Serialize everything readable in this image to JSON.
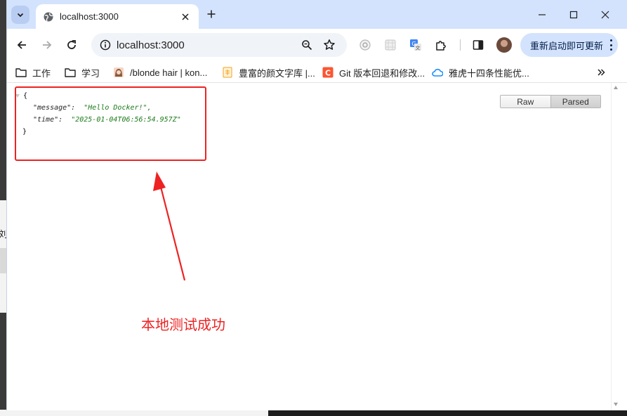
{
  "browser": {
    "tab": {
      "title": "localhost:3000"
    },
    "omnibox": {
      "url": "localhost:3000"
    },
    "update_button_label": "重新启动即可更新",
    "bookmarks": [
      {
        "label": "工作",
        "icon": "folder-icon"
      },
      {
        "label": "学习",
        "icon": "folder-icon"
      },
      {
        "label": "/blonde hair | kon...",
        "icon": "avatar-favicon"
      },
      {
        "label": "豊富的颜文字库 |...",
        "icon": "doc-favicon"
      },
      {
        "label": "Git 版本回退和修改...",
        "icon": "csdn-favicon"
      },
      {
        "label": "雅虎十四条性能优...",
        "icon": "cloud-favicon"
      }
    ]
  },
  "json_viewer": {
    "open_brace": "{",
    "close_brace": "}",
    "entries": [
      {
        "key": "\"message\":",
        "value": "\"Hello Docker!\","
      },
      {
        "key": "\"time\":",
        "value": "\"2025-01-04T06:56:54.957Z\""
      }
    ],
    "view_options": [
      "Raw",
      "Parsed"
    ],
    "active_view": "Parsed"
  },
  "annotation": {
    "caption": "本地测试成功",
    "color": "#ee2222"
  },
  "background": {
    "left_glyph": "刘"
  }
}
